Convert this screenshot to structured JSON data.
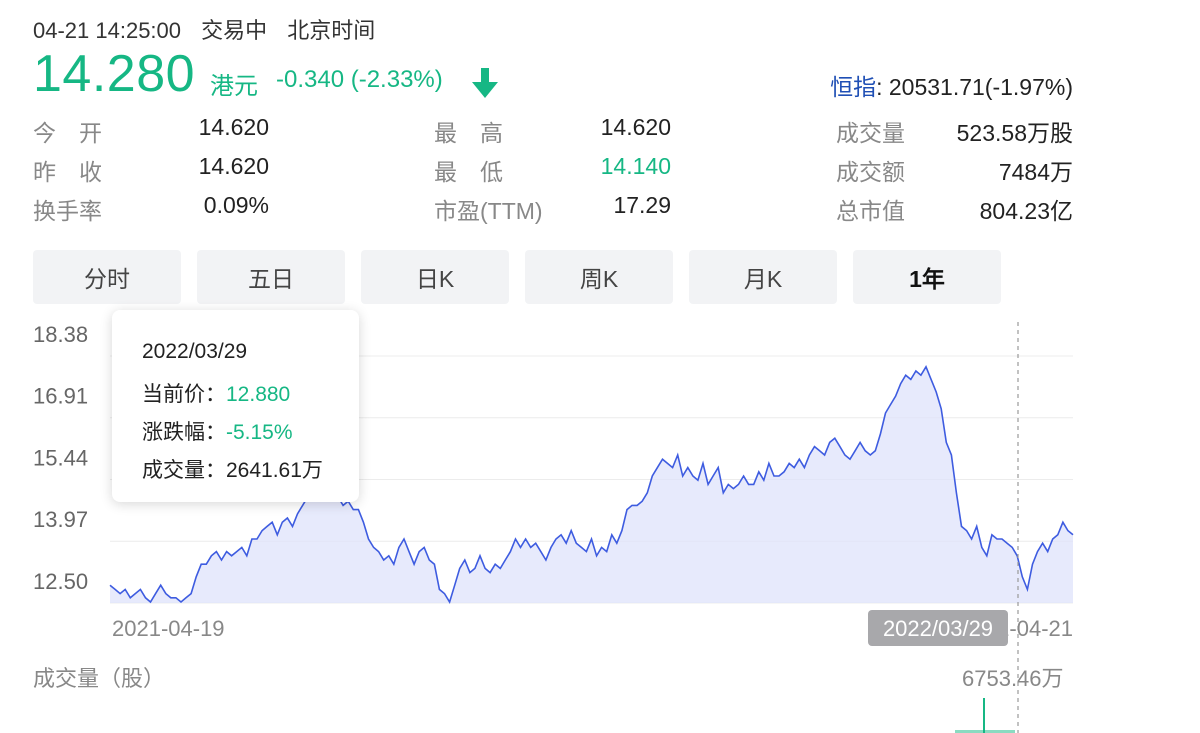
{
  "header": {
    "date": "04-21 14:25:00",
    "status": "交易中",
    "timezone": "北京时间",
    "price": "14.280",
    "currency": "港元",
    "change": "-0.340 (-2.33%)",
    "index_label": "恒指",
    "index_value": ": 20531.71(-1.97%)"
  },
  "stats": [
    {
      "label": "今　开",
      "value": "14.620"
    },
    {
      "label": "最　高",
      "value": "14.620"
    },
    {
      "label": "成交量",
      "value": "523.58万股"
    },
    {
      "label": "昨　收",
      "value": "14.620"
    },
    {
      "label": "最　低",
      "value": "14.140"
    },
    {
      "label": "成交额",
      "value": "7484万"
    },
    {
      "label": "换手率",
      "value": "0.09%"
    },
    {
      "label": "市盈(TTM)",
      "value": "17.29"
    },
    {
      "label": "总市值",
      "value": "804.23亿"
    }
  ],
  "tabs": [
    "分时",
    "五日",
    "日K",
    "周K",
    "月K",
    "1年"
  ],
  "active_tab": "1年",
  "colors": {
    "down": "#16b784",
    "line": "#3e5ce0",
    "fill": "#dfe3fb",
    "index_link": "#1f4fb5"
  },
  "tooltip": {
    "date": "2022/03/29",
    "price_label": "当前价：",
    "price_value": "12.880",
    "change_label": "涨跌幅：",
    "change_value": "-5.15%",
    "volume_label": "成交量：",
    "volume_value": "2641.61万"
  },
  "volume": {
    "label": "成交量（股）",
    "max": "6753.46万"
  },
  "chart_data": {
    "type": "area",
    "y_ticks": [
      "18.38",
      "16.91",
      "15.44",
      "13.97",
      "12.50"
    ],
    "ylim": [
      12.0,
      18.38
    ],
    "x_labels": [
      "2021-04-19",
      "2022-04-21"
    ],
    "crosshair_label": "2022/03/29",
    "grid": true,
    "series": [
      {
        "values": [
          12.4,
          12.3,
          12.2,
          12.3,
          12.1,
          12.2,
          12.3,
          12.1,
          12.0,
          12.2,
          12.4,
          12.2,
          12.1,
          12.1,
          12.0,
          12.1,
          12.2,
          12.6,
          12.9,
          12.9,
          13.1,
          13.2,
          13.0,
          13.2,
          13.1,
          13.2,
          13.3,
          13.1,
          13.5,
          13.5,
          13.7,
          13.8,
          13.9,
          13.6,
          13.9,
          14.0,
          13.8,
          14.1,
          14.3,
          14.5,
          14.8,
          15.2,
          15.3,
          15.1,
          14.6,
          14.5,
          14.3,
          14.4,
          14.2,
          14.2,
          13.9,
          13.5,
          13.3,
          13.2,
          13.0,
          13.1,
          12.9,
          13.3,
          13.5,
          13.2,
          12.9,
          13.2,
          13.3,
          13.0,
          12.9,
          12.3,
          12.2,
          12.0,
          12.4,
          12.8,
          13.0,
          12.7,
          12.8,
          13.1,
          12.8,
          12.7,
          12.9,
          12.8,
          13.0,
          13.2,
          13.5,
          13.3,
          13.5,
          13.3,
          13.4,
          13.2,
          13.0,
          13.3,
          13.5,
          13.6,
          13.4,
          13.7,
          13.4,
          13.3,
          13.2,
          13.5,
          13.1,
          13.3,
          13.2,
          13.6,
          13.4,
          13.7,
          14.2,
          14.3,
          14.3,
          14.4,
          14.6,
          15.0,
          15.2,
          15.4,
          15.3,
          15.2,
          15.5,
          15.0,
          15.2,
          15.0,
          14.9,
          15.3,
          14.8,
          15.0,
          15.2,
          14.6,
          14.8,
          14.7,
          14.8,
          15.0,
          14.8,
          14.8,
          15.1,
          14.9,
          15.3,
          15.0,
          15.0,
          15.1,
          15.3,
          15.2,
          15.4,
          15.2,
          15.5,
          15.7,
          15.6,
          15.5,
          15.8,
          15.9,
          15.7,
          15.5,
          15.4,
          15.6,
          15.8,
          15.6,
          15.5,
          15.6,
          16.0,
          16.5,
          16.7,
          16.9,
          17.2,
          17.4,
          17.3,
          17.5,
          17.4,
          17.6,
          17.3,
          17.0,
          16.6,
          15.8,
          15.5,
          14.6,
          13.8,
          13.7,
          13.5,
          13.8,
          13.3,
          13.1,
          13.6,
          13.5,
          13.5,
          13.4,
          13.3,
          13.1,
          12.6,
          12.3,
          12.9,
          13.2,
          13.4,
          13.2,
          13.5,
          13.6,
          13.9,
          13.7,
          13.6
        ]
      }
    ]
  }
}
